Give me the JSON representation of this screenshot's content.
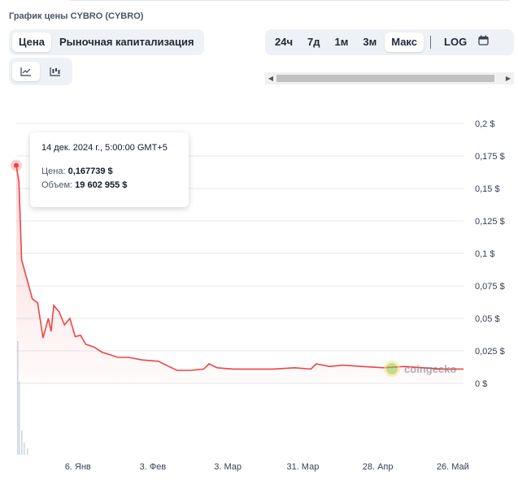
{
  "header": {
    "title": "График цены CYBRO (CYBRO)"
  },
  "type_tabs": [
    {
      "label": "Цена",
      "active": true
    },
    {
      "label": "Рыночная капитализация",
      "active": false
    }
  ],
  "view_buttons": [
    {
      "icon": "line-chart-icon",
      "active": true
    },
    {
      "icon": "candlestick-chart-icon",
      "active": false
    }
  ],
  "range_tabs": [
    {
      "label": "24ч",
      "active": false
    },
    {
      "label": "7д",
      "active": false
    },
    {
      "label": "1м",
      "active": false
    },
    {
      "label": "3м",
      "active": false
    },
    {
      "label": "Макс",
      "active": true
    }
  ],
  "log_label": "LOG",
  "calendar_icon": "calendar-icon",
  "tooltip": {
    "date": "14 дек. 2024 г., 5:00:00 GMT+5",
    "price_label": "Цена:",
    "price_value": "0,167739 $",
    "volume_label": "Объем:",
    "volume_value": "19 602 955 $"
  },
  "watermark": "coingecko",
  "colors": {
    "line": "#ef4444",
    "fill": "#fee2e2",
    "volume": "#cbd5e1"
  },
  "chart_data": {
    "type": "line",
    "title": "График цены CYBRO (CYBRO)",
    "xlabel": "",
    "ylabel": "",
    "x_start": "2024-12-14",
    "x_end": "2025-05-30",
    "x_ticks": [
      {
        "date": "2025-01-06",
        "label": "6. Янв"
      },
      {
        "date": "2025-02-03",
        "label": "3. Фев"
      },
      {
        "date": "2025-03-03",
        "label": "3. Мар"
      },
      {
        "date": "2025-03-31",
        "label": "31. Мар"
      },
      {
        "date": "2025-04-28",
        "label": "28. Апр"
      },
      {
        "date": "2025-05-26",
        "label": "26. Май"
      }
    ],
    "ylim": [
      0,
      0.2
    ],
    "y_ticks": [
      {
        "value": 0.2,
        "label": "0,2 $"
      },
      {
        "value": 0.175,
        "label": "0,175 $"
      },
      {
        "value": 0.15,
        "label": "0,15 $"
      },
      {
        "value": 0.125,
        "label": "0,125 $"
      },
      {
        "value": 0.1,
        "label": "0,1 $"
      },
      {
        "value": 0.075,
        "label": "0,075 $"
      },
      {
        "value": 0.05,
        "label": "0,05 $"
      },
      {
        "value": 0.025,
        "label": "0,025 $"
      },
      {
        "value": 0,
        "label": "0 $"
      }
    ],
    "grid": true,
    "legend": "none",
    "series": [
      {
        "points": [
          [
            "2024-12-14",
            0.1677
          ],
          [
            "2024-12-15",
            0.155
          ],
          [
            "2024-12-16",
            0.095
          ],
          [
            "2024-12-18",
            0.08
          ],
          [
            "2024-12-20",
            0.065
          ],
          [
            "2024-12-22",
            0.062
          ],
          [
            "2024-12-24",
            0.035
          ],
          [
            "2024-12-26",
            0.05
          ],
          [
            "2024-12-27",
            0.04
          ],
          [
            "2024-12-28",
            0.06
          ],
          [
            "2024-12-30",
            0.055
          ],
          [
            "2025-01-01",
            0.045
          ],
          [
            "2025-01-03",
            0.05
          ],
          [
            "2025-01-05",
            0.036
          ],
          [
            "2025-01-07",
            0.037
          ],
          [
            "2025-01-09",
            0.03
          ],
          [
            "2025-01-12",
            0.028
          ],
          [
            "2025-01-15",
            0.024
          ],
          [
            "2025-01-18",
            0.022
          ],
          [
            "2025-01-21",
            0.02
          ],
          [
            "2025-01-25",
            0.02
          ],
          [
            "2025-01-30",
            0.018
          ],
          [
            "2025-02-05",
            0.017
          ],
          [
            "2025-02-09",
            0.013
          ],
          [
            "2025-02-12",
            0.01
          ],
          [
            "2025-02-17",
            0.01
          ],
          [
            "2025-02-22",
            0.011
          ],
          [
            "2025-02-24",
            0.015
          ],
          [
            "2025-02-27",
            0.012
          ],
          [
            "2025-03-05",
            0.011
          ],
          [
            "2025-03-12",
            0.011
          ],
          [
            "2025-03-20",
            0.011
          ],
          [
            "2025-03-28",
            0.012
          ],
          [
            "2025-04-03",
            0.011
          ],
          [
            "2025-04-05",
            0.015
          ],
          [
            "2025-04-10",
            0.013
          ],
          [
            "2025-04-15",
            0.014
          ],
          [
            "2025-04-22",
            0.013
          ],
          [
            "2025-04-30",
            0.012
          ],
          [
            "2025-05-08",
            0.013
          ],
          [
            "2025-05-15",
            0.012
          ],
          [
            "2025-05-22",
            0.011
          ],
          [
            "2025-05-30",
            0.011
          ]
        ]
      }
    ]
  }
}
